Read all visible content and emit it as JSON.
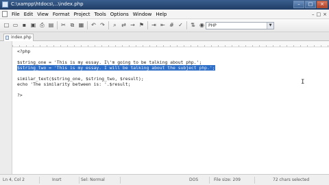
{
  "window": {
    "title": "C:\\xampp\\htdocs\\...\\index.php",
    "minimize_glyph": "–",
    "maximize_glyph": "□",
    "close_glyph": "×"
  },
  "menu": [
    "File",
    "Edit",
    "View",
    "Format",
    "Project",
    "Tools",
    "Options",
    "Window",
    "Help"
  ],
  "mdi_buttons": {
    "minimize": "–",
    "restore": "□",
    "close": "×"
  },
  "toolbar": {
    "icons": [
      "new-icon",
      "open-icon",
      "save-icon",
      "save-all-icon",
      "print-icon",
      "print-preview-icon",
      "cut-icon",
      "copy-icon",
      "paste-icon",
      "undo-icon",
      "redo-icon",
      "find-icon",
      "replace-icon",
      "go-to-icon",
      "bookmark-icon",
      "indent-icon",
      "outdent-icon",
      "comment-icon",
      "spell-check-icon",
      "ftp-icon",
      "preview-icon"
    ],
    "glyphs": [
      "□",
      "▭",
      "▪",
      "▣",
      "⎙",
      "▤",
      "✂",
      "⧉",
      "▦",
      "↶",
      "↷",
      "⌕",
      "⇄",
      "→",
      "⚑",
      "⇥",
      "⇤",
      "#",
      "✓",
      "⇅",
      "◉"
    ],
    "language": "PHP"
  },
  "tab": {
    "label": "index.php"
  },
  "code": {
    "lines": [
      "<?php",
      "",
      "$string_one = 'This is my essay. I\\'m going to be talking about php.';",
      "$string_two = 'This is my essay. I will be talking about the subject php.';",
      "",
      "similar_text($string_one, $string_two, $result);",
      "echo 'The similarity between is: '.$result;",
      "",
      "?>"
    ],
    "selected_line_index": 3
  },
  "status": {
    "position": "Ln 4, Col 2",
    "mode": "Insrt",
    "selection_mode": "Sel: Normal",
    "encoding": "DOS",
    "file_size": "File size: 209",
    "selected_chars": "72 chars selected"
  },
  "colors": {
    "titlebar": "#2b4c7a",
    "selection": "#2f6fc7",
    "editor_bg": "#ffffff"
  }
}
